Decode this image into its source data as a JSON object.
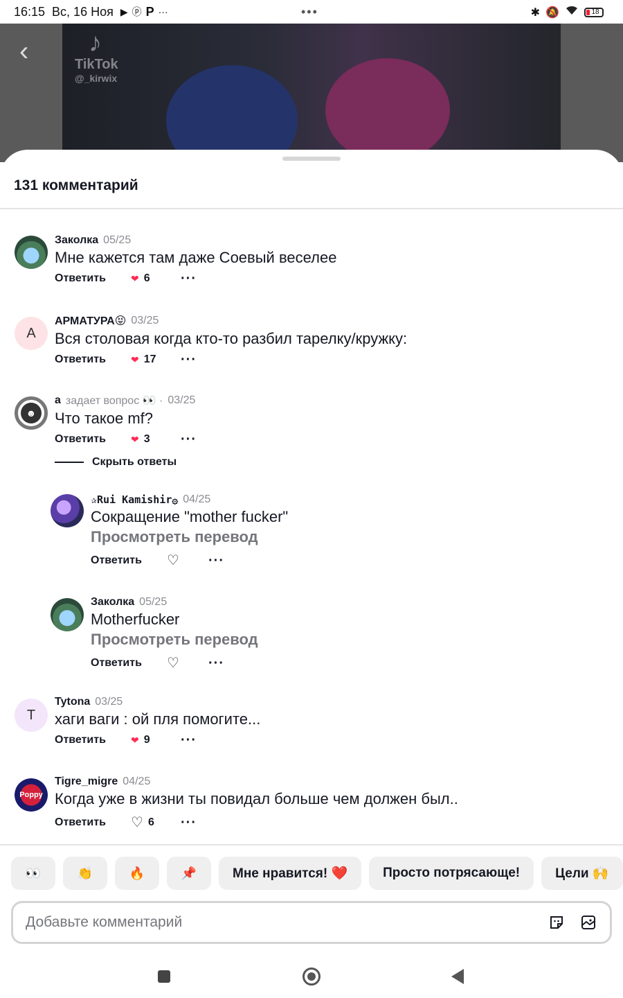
{
  "status_bar": {
    "time": "16:15",
    "date": "Вс, 16 Ноя",
    "left_icons": [
      "youtube-icon",
      "pinterest-icon",
      "p-app-icon"
    ],
    "more": "···",
    "center_dots": "•••",
    "battery": "18"
  },
  "video": {
    "logo_text": "TikTok",
    "handle": "@_kirwix"
  },
  "sheet": {
    "title": "131 комментарий"
  },
  "comments": [
    {
      "user": "Заколка",
      "date": "05/25",
      "text": "Мне кажется там даже Соевый веселее",
      "reply": "Ответить",
      "likes": "6",
      "liked_style": "filled"
    },
    {
      "user": "АРМАТУРА😝",
      "date": "03/25",
      "text": "Вся столовая когда кто-то разбил тарелку/кружку:",
      "reply": "Ответить",
      "likes": "17",
      "avatar_letter": "А"
    },
    {
      "user": "а",
      "date": "03/25",
      "subtitle": "задает вопрос 👀 ·",
      "text": "Что такое mf?",
      "reply": "Ответить",
      "likes": "3"
    },
    {
      "user": "Tytona",
      "date": "03/25",
      "text": "хаги ваги : ой пля помогите...",
      "reply": "Ответить",
      "likes": "9",
      "avatar_letter": "T"
    },
    {
      "user": "Tigre_migre",
      "date": "04/25",
      "text": "Когда уже в жизни ты повидал больше чем должен был..",
      "reply": "Ответить",
      "likes": "6"
    }
  ],
  "hide_replies": "Скрыть ответы",
  "replies": [
    {
      "user": "✰Rui Kamishir۞",
      "date": "04/25",
      "text": "Сокращение \"mother fucker\"",
      "translate": "Просмотреть перевод",
      "reply": "Ответить"
    },
    {
      "user": "Заколка",
      "date": "05/25",
      "text": "Motherfucker",
      "translate": "Просмотреть перевод",
      "reply": "Ответить"
    }
  ],
  "poppy_avatar_text": "Poppy",
  "reactions": {
    "emoji": [
      "👀",
      "👏",
      "🔥",
      "📌"
    ],
    "text": [
      "Мне нравится! ❤️",
      "Просто потрясающе!",
      "Цели 🙌"
    ]
  },
  "input": {
    "placeholder": "Добавьте комментарий"
  },
  "colors": {
    "like_red": "#fe2c55",
    "text_primary": "#161823",
    "text_secondary": "#8a8b91",
    "chip_bg": "#efefef"
  }
}
